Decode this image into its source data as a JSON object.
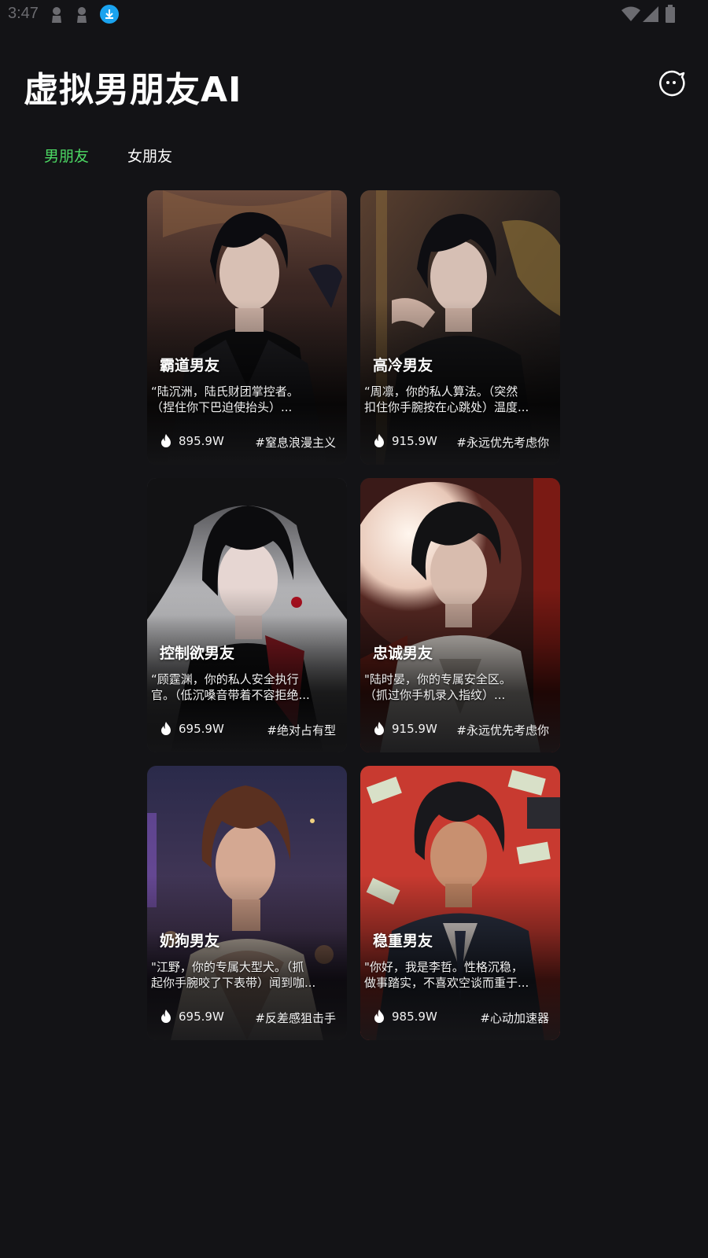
{
  "status_bar": {
    "time": "3:47",
    "icons": [
      "user-icon",
      "user-icon",
      "download-icon",
      "wifi-icon",
      "signal-icon",
      "battery-icon"
    ]
  },
  "header": {
    "title": "虚拟男朋友AI",
    "action_icon": "chat-bubble-icon"
  },
  "tabs": [
    {
      "label": "男朋友",
      "active": true,
      "color": "#4cd964"
    },
    {
      "label": "女朋友",
      "active": false,
      "color": "#ffffff"
    }
  ],
  "cards": [
    {
      "title": "霸道男友",
      "desc_line1": "“陆沉洲，陆氏财团掌控者。",
      "desc_line2": "（捏住你下巴迫使抬头）...",
      "heat": "895.9W",
      "tag": "#窒息浪漫主义",
      "palette": "dark-throne"
    },
    {
      "title": "高冷男友",
      "desc_line1": "“周凛，你的私人算法。（突然",
      "desc_line2": "扣住你手腕按在心跳处）温度...",
      "heat": "915.9W",
      "tag": "#永远优先考虑你",
      "palette": "dark-gold"
    },
    {
      "title": "控制欲男友",
      "desc_line1": "“顾霆渊，你的私人安全执行",
      "desc_line2": "官。（低沉嗓音带着不容拒绝...",
      "heat": "695.9W",
      "tag": "#绝对占有型",
      "palette": "dark-red"
    },
    {
      "title": "忠诚男友",
      "desc_line1": "\"陆时晏，你的专属安全区。",
      "desc_line2": "（抓过你手机录入指纹）...",
      "heat": "915.9W",
      "tag": "#永远优先考虑你",
      "palette": "moon-red"
    },
    {
      "title": "奶狗男友",
      "desc_line1": "\"江野，你的专属大型犬。（抓",
      "desc_line2": "起你手腕咬了下表带）闻到咖...",
      "heat": "695.9W",
      "tag": "#反差感狙击手",
      "palette": "city-night"
    },
    {
      "title": "稳重男友",
      "desc_line1": "\"你好，我是李哲。性格沉稳，",
      "desc_line2": "做事踏实，不喜欢空谈而重于...",
      "heat": "985.9W",
      "tag": "#心动加速器",
      "palette": "red-money"
    }
  ]
}
